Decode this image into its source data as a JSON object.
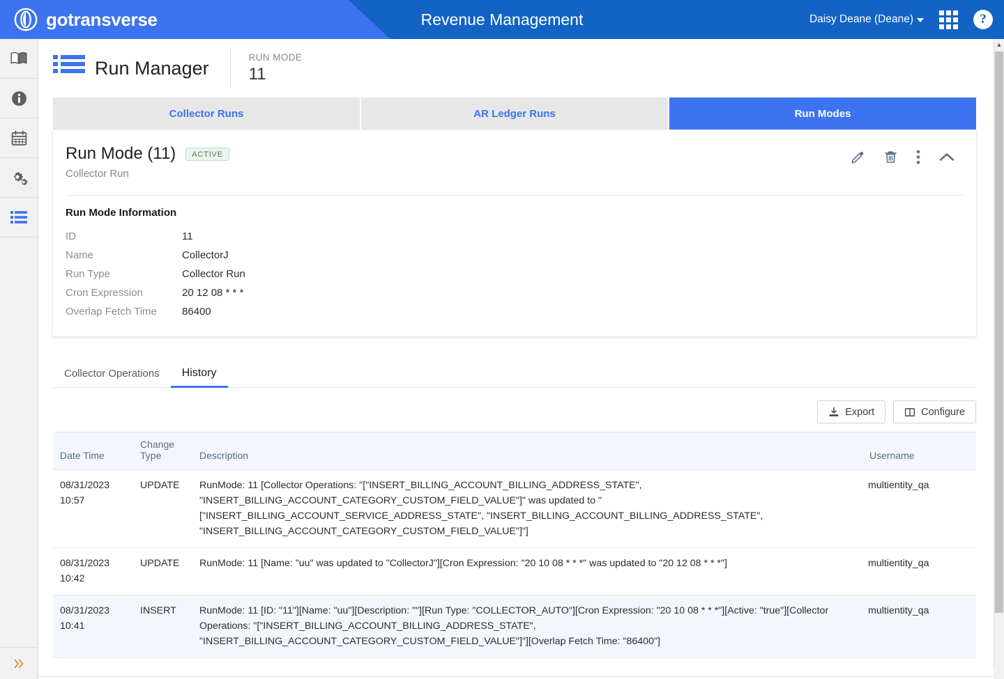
{
  "topbar": {
    "brand": "gotransverse",
    "brand_logo_icon": "circle-lens-icon",
    "app_title": "Revenue Management",
    "user_menu": "Daisy Deane (Deane)",
    "apps_icon": "grid-apps-icon",
    "help_icon": "help-circle-icon",
    "accent_blue": "#3b73f0",
    "header_blue": "#1263c4"
  },
  "sidebar": {
    "items": [
      {
        "icon": "book-icon",
        "name": "sidebar-item-book",
        "active": false
      },
      {
        "icon": "info-icon",
        "name": "sidebar-item-info",
        "active": false
      },
      {
        "icon": "calendar-icon",
        "name": "sidebar-item-calendar",
        "active": false
      },
      {
        "icon": "gears-icon",
        "name": "sidebar-item-settings",
        "active": false
      },
      {
        "icon": "list-icon",
        "name": "sidebar-item-run-manager",
        "active": true
      }
    ],
    "expand_icon": "chevron-double-right-icon"
  },
  "page": {
    "icon": "list-icon",
    "title": "Run Manager",
    "meta_label": "RUN MODE",
    "meta_value": "11"
  },
  "tabs": [
    {
      "label": "Collector Runs",
      "active": false
    },
    {
      "label": "AR Ledger Runs",
      "active": false
    },
    {
      "label": "Run Modes",
      "active": true
    }
  ],
  "card": {
    "title": "Run Mode (11)",
    "status_badge": "ACTIVE",
    "subtitle": "Collector Run",
    "actions": [
      {
        "icon": "pencil-icon",
        "name": "edit-button"
      },
      {
        "icon": "trash-icon",
        "name": "delete-button"
      },
      {
        "icon": "vertical-dots-icon",
        "name": "more-options-button"
      },
      {
        "icon": "chevron-up-icon",
        "name": "collapse-button"
      }
    ],
    "section_title": "Run Mode Information",
    "fields": [
      {
        "label": "ID",
        "value": "11"
      },
      {
        "label": "Name",
        "value": "CollectorJ"
      },
      {
        "label": "Run Type",
        "value": "Collector Run"
      },
      {
        "label": "Cron Expression",
        "value": "20 12 08 * * *"
      },
      {
        "label": "Overlap Fetch Time",
        "value": "86400"
      }
    ]
  },
  "subtabs": [
    {
      "label": "Collector Operations",
      "active": false
    },
    {
      "label": "History",
      "active": true
    }
  ],
  "toolbar": {
    "export_label": "Export",
    "export_icon": "download-icon",
    "configure_label": "Configure",
    "configure_icon": "columns-icon"
  },
  "table": {
    "columns": [
      "Date Time",
      "Change Type",
      "Description",
      "Username"
    ],
    "rows": [
      {
        "datetime": "08/31/2023\n10:57",
        "change_type": "UPDATE",
        "description": "RunMode: 11 [Collector Operations: \"[\"INSERT_BILLING_ACCOUNT_BILLING_ADDRESS_STATE\", \"INSERT_BILLING_ACCOUNT_CATEGORY_CUSTOM_FIELD_VALUE\"]\" was updated to \"[\"INSERT_BILLING_ACCOUNT_SERVICE_ADDRESS_STATE\", \"INSERT_BILLING_ACCOUNT_BILLING_ADDRESS_STATE\", \"INSERT_BILLING_ACCOUNT_CATEGORY_CUSTOM_FIELD_VALUE\"]\"]",
        "username": "multientity_qa"
      },
      {
        "datetime": "08/31/2023\n10:42",
        "change_type": "UPDATE",
        "description": "RunMode: 11 [Name: \"uu\" was updated to \"CollectorJ\"][Cron Expression: \"20 10 08 * * *\" was updated to \"20 12 08 * * *\"]",
        "username": "multientity_qa"
      },
      {
        "datetime": "08/31/2023\n10:41",
        "change_type": "INSERT",
        "description": "RunMode: 11 [ID: \"11\"][Name: \"uu\"][Description: \"\"][Run Type: \"COLLECTOR_AUTO\"][Cron Expression: \"20 10 08 * * *\"][Active: \"true\"][Collector Operations: \"[\"INSERT_BILLING_ACCOUNT_BILLING_ADDRESS_STATE\", \"INSERT_BILLING_ACCOUNT_CATEGORY_CUSTOM_FIELD_VALUE\"]\"][Overlap Fetch Time: \"86400\"]",
        "username": "multientity_qa"
      }
    ]
  }
}
